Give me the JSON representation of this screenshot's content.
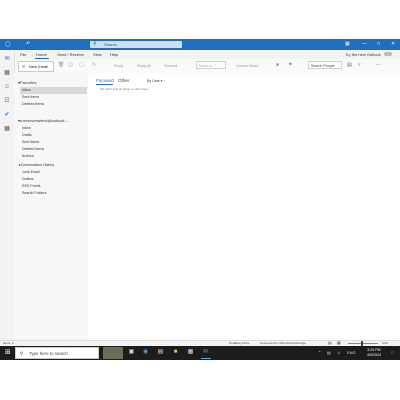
{
  "titlebar": {
    "search_placeholder": "Search",
    "colors": {
      "bar": "#1e6fc0",
      "search_bg": "#cfe0f3"
    }
  },
  "ribbon_tabs": [
    "File",
    "Home",
    "Send / Receive",
    "View",
    "Help"
  ],
  "try_new_outlook": "Try the new Outlook",
  "toolbar": {
    "new_email": "New Email",
    "reply": "Reply",
    "reply_all": "Reply All",
    "forward": "Forward",
    "move_to": "Move to: ?",
    "unread_read": "Unread/ Read",
    "search_people": "Search People"
  },
  "favorites": {
    "header": "Favorites",
    "items": [
      "Inbox",
      "Sent Items",
      "Deleted Items"
    ]
  },
  "account": {
    "header": "ruxeroversetest@outlook...",
    "items": [
      "Inbox",
      "Drafts",
      "Sent Items",
      "Deleted Items",
      "Archive",
      "Conversation History",
      "Junk Email",
      "Outbox",
      "RSS Feeds",
      "Search Folders"
    ]
  },
  "message_list": {
    "tab_focused": "Focused",
    "tab_other": "Other",
    "sort": "By Date",
    "empty_text": "We didn't find anything to show here."
  },
  "statusbar": {
    "items": "Items: 0",
    "sync": "Updating Inbox.",
    "connection": "Connected to: Microsoft Exchange",
    "zoom": "10%"
  },
  "taskbar": {
    "search_placeholder": "Type here to search",
    "time": "3:29 PM",
    "date": "4/9/2024"
  }
}
